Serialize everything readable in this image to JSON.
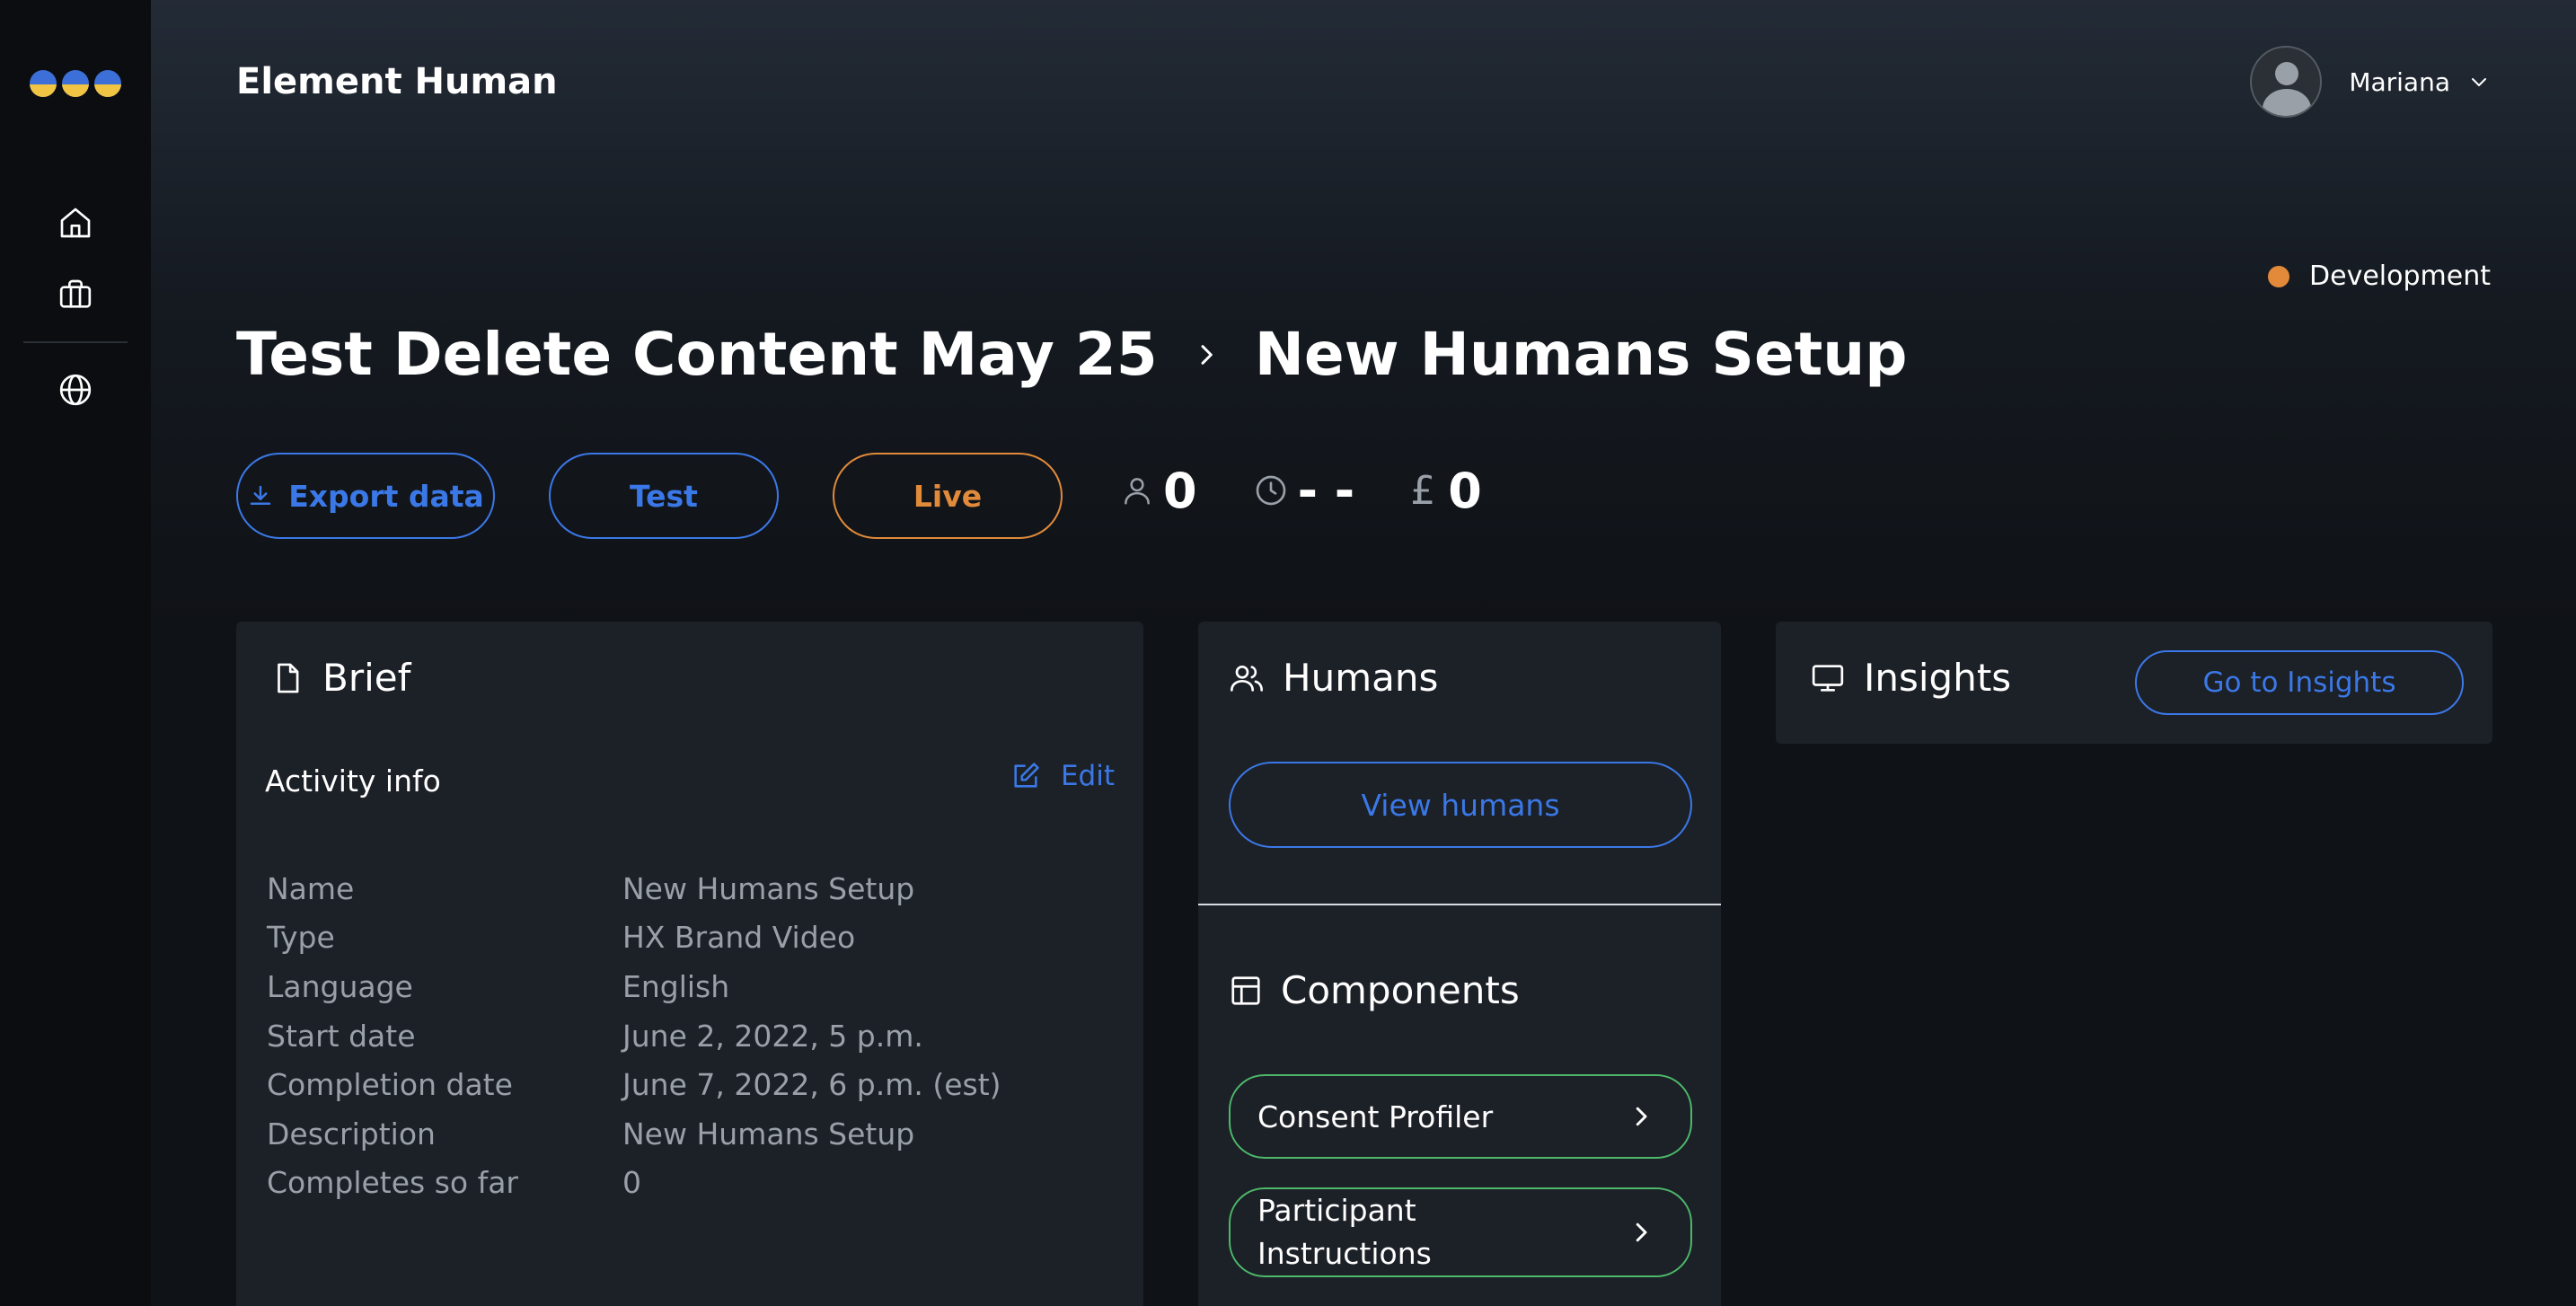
{
  "app": {
    "title": "Element Human"
  },
  "user": {
    "name": "Mariana"
  },
  "environment": {
    "label": "Development",
    "color": "#e28a3a"
  },
  "breadcrumb": {
    "parent": "Test Delete Content May 25",
    "current": "New Humans Setup"
  },
  "actions": {
    "export_label": "Export data",
    "test_label": "Test",
    "live_label": "Live"
  },
  "stats": {
    "participants": "0",
    "duration": "- -",
    "currency_symbol": "£",
    "cost": "0"
  },
  "brief": {
    "title": "Brief",
    "section_label": "Activity info",
    "edit_label": "Edit",
    "rows": [
      {
        "key": "Name",
        "value": "New Humans Setup"
      },
      {
        "key": "Type",
        "value": "HX Brand Video"
      },
      {
        "key": "Language",
        "value": "English"
      },
      {
        "key": "Start date",
        "value": "June 2, 2022, 5 p.m."
      },
      {
        "key": "Completion date",
        "value": "June 7, 2022, 6 p.m. (est)"
      },
      {
        "key": "Description",
        "value": "New Humans Setup"
      },
      {
        "key": "Completes so far",
        "value": "0"
      }
    ]
  },
  "humans": {
    "title": "Humans",
    "view_label": "View humans"
  },
  "components": {
    "title": "Components",
    "items": [
      {
        "label": "Consent Profiler"
      },
      {
        "label": "Participant Instructions"
      }
    ]
  },
  "insights": {
    "title": "Insights",
    "button_label": "Go to Insights"
  },
  "colors": {
    "accent_blue": "#3b78e7",
    "live_orange": "#e08a3a",
    "component_green": "#4db86a",
    "logo_blue": "#3c6fd8",
    "logo_yellow": "#f2c443"
  },
  "icons": [
    "home-icon",
    "briefcase-icon",
    "globe-icon",
    "download-icon",
    "user-icon",
    "clock-icon",
    "document-icon",
    "edit-icon",
    "users-icon",
    "layout-icon",
    "monitor-icon",
    "chevron-right-icon",
    "chevron-down-icon"
  ]
}
